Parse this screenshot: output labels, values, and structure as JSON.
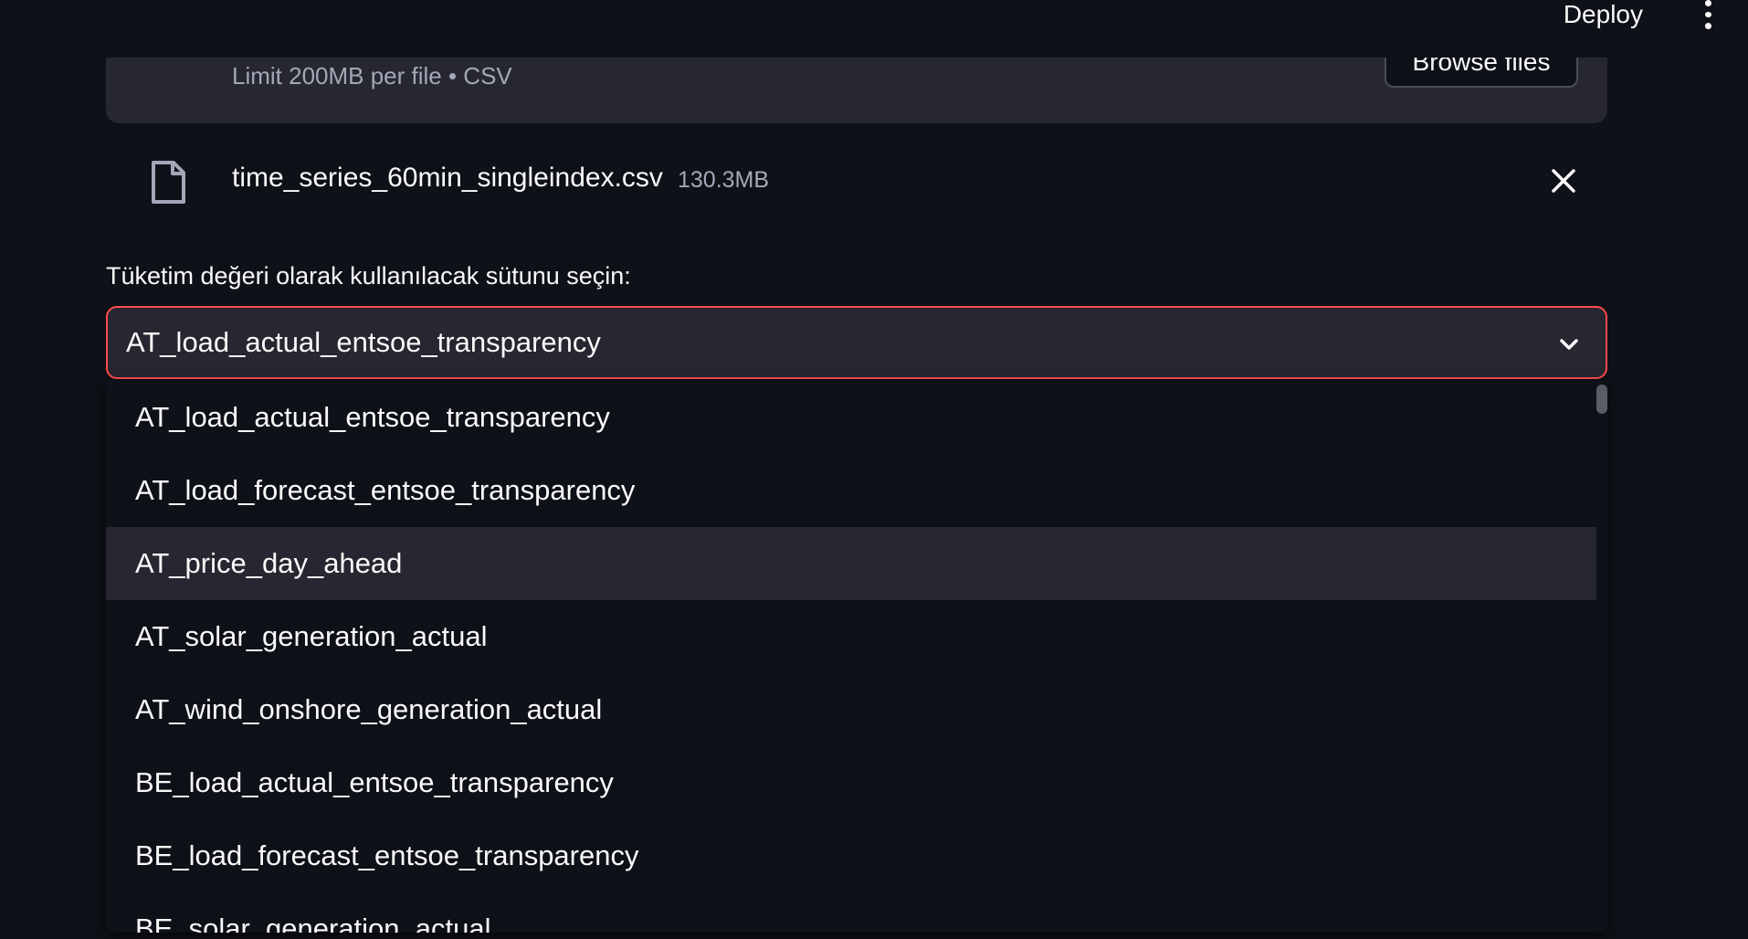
{
  "header": {
    "deploy_label": "Deploy"
  },
  "uploader": {
    "limit_text": "Limit 200MB per file • CSV",
    "browse_label": "Browse files"
  },
  "file": {
    "name": "time_series_60min_singleindex.csv",
    "size": "130.3MB"
  },
  "select": {
    "label": "Tüketim değeri olarak kullanılacak sütunu seçin:",
    "value": "AT_load_actual_entsoe_transparency",
    "accent_color": "#ff4b4b",
    "options": [
      "AT_load_actual_entsoe_transparency",
      "AT_load_forecast_entsoe_transparency",
      "AT_price_day_ahead",
      "AT_solar_generation_actual",
      "AT_wind_onshore_generation_actual",
      "BE_load_actual_entsoe_transparency",
      "BE_load_forecast_entsoe_transparency",
      "BE_solar_generation_actual"
    ],
    "hovered_option": "AT_price_day_ahead"
  }
}
